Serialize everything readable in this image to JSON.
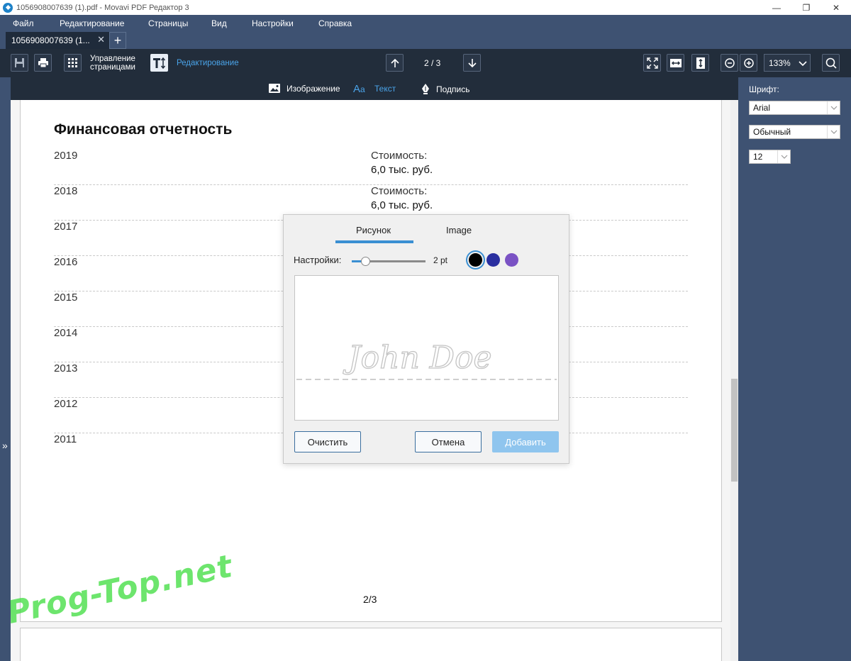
{
  "window": {
    "title": "1056908007639 (1).pdf - Movavi PDF Редактор 3",
    "controls": {
      "minimize": "—",
      "restore": "❐",
      "close": "✕"
    }
  },
  "menu": {
    "items": [
      "Файл",
      "Редактирование",
      "Страницы",
      "Вид",
      "Настройки",
      "Справка"
    ]
  },
  "tabs": {
    "doc_tab": "1056908007639 (1...",
    "close_glyph": "✕",
    "add_glyph": "+"
  },
  "toolbar": {
    "manage_pages_line1": "Управление",
    "manage_pages_line2": "страницами",
    "editing_label": "Редактирование",
    "page_indicator": "2 / 3",
    "zoom": "133%"
  },
  "subtoolbar": {
    "image_label": "Изображение",
    "text_label": "Текст",
    "signature_label": "Подпись"
  },
  "right_panel": {
    "font_heading": "Шрифт:",
    "font_family": "Arial",
    "font_style": "Обычный",
    "font_size": "12"
  },
  "document": {
    "title": "Финансовая отчетность",
    "rows": [
      {
        "year": "2019",
        "cost_label": "Стоимость:",
        "cost_value": "6,0 тыс. руб."
      },
      {
        "year": "2018",
        "cost_label": "Стоимость:",
        "cost_value": "6,0 тыс. руб."
      },
      {
        "year": "2017"
      },
      {
        "year": "2016"
      },
      {
        "year": "2015"
      },
      {
        "year": "2014"
      },
      {
        "year": "2013"
      },
      {
        "year": "2012"
      },
      {
        "year": "2011"
      }
    ],
    "page_number": "2/3"
  },
  "dialog": {
    "tab_draw": "Рисунок",
    "tab_image": "Image",
    "settings_label": "Настройки:",
    "thickness": "2 pt",
    "colors": [
      "#000000",
      "#2a2fa0",
      "#7a52c4"
    ],
    "signature_text": "John Doe",
    "clear_button": "Очистить",
    "cancel_button": "Отмена",
    "add_button": "Добавить"
  },
  "sidebar_toggle": "»",
  "watermark": "Prog-Top.net"
}
